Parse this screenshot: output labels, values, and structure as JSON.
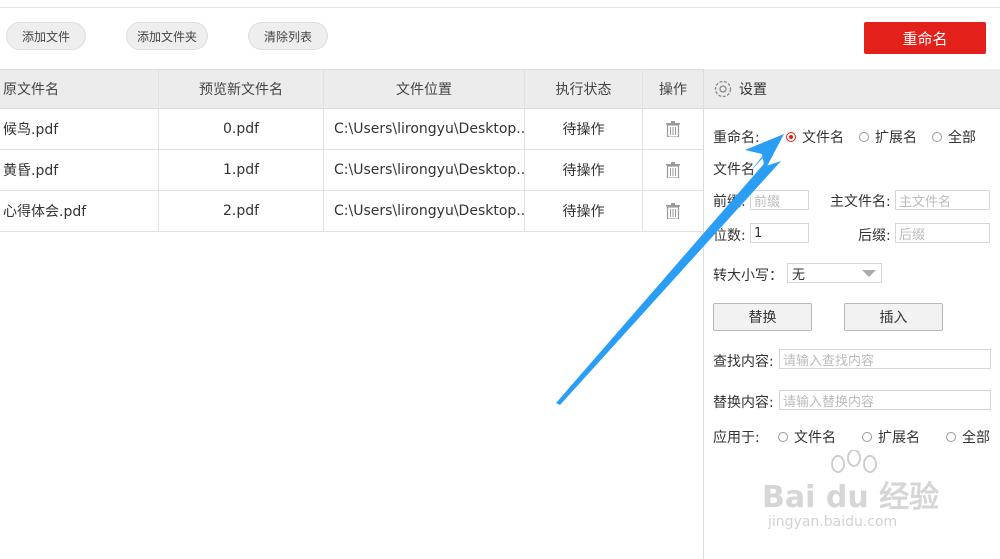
{
  "toolbar": {
    "add_file": "添加文件",
    "add_folder": "添加文件夹",
    "clear_list": "清除列表",
    "rename": "重命名"
  },
  "table": {
    "headers": [
      "原文件名",
      "预览新文件名",
      "文件位置",
      "执行状态",
      "操作"
    ],
    "rows": [
      {
        "original": "候鸟.pdf",
        "preview": "0.pdf",
        "location": "C:\\Users\\lirongyu\\Desktop...",
        "status": "待操作"
      },
      {
        "original": "黄昏.pdf",
        "preview": "1.pdf",
        "location": "C:\\Users\\lirongyu\\Desktop...",
        "status": "待操作"
      },
      {
        "original": "心得体会.pdf",
        "preview": "2.pdf",
        "location": "C:\\Users\\lirongyu\\Desktop...",
        "status": "待操作"
      }
    ]
  },
  "settings": {
    "title": "设置",
    "rename_label": "重命名:",
    "rename_options": [
      "文件名",
      "扩展名",
      "全部"
    ],
    "rename_selected": "文件名",
    "filename_section": "文件名",
    "prefix_label": "前缀:",
    "prefix_placeholder": "前缀",
    "main_name_label": "主文件名:",
    "main_name_placeholder": "主文件名",
    "digits_label": "位数:",
    "digits_value": "1",
    "suffix_label": "后缀:",
    "suffix_placeholder": "后缀",
    "case_label": "转大小写：",
    "case_value": "无",
    "replace_button": "替换",
    "insert_button": "插入",
    "find_label": "查找内容:",
    "find_placeholder": "请输入查找内容",
    "replace_label": "替换内容:",
    "replace_placeholder": "请输入替换内容",
    "apply_label": "应用于:",
    "apply_options": [
      "文件名",
      "扩展名",
      "全部"
    ]
  },
  "watermark": {
    "brand": "Bai du 经验",
    "url": "jingyan.baidu.com"
  },
  "colors": {
    "accent": "#e3211a",
    "arrow": "#2a9df4",
    "header_bg": "#ececec"
  }
}
